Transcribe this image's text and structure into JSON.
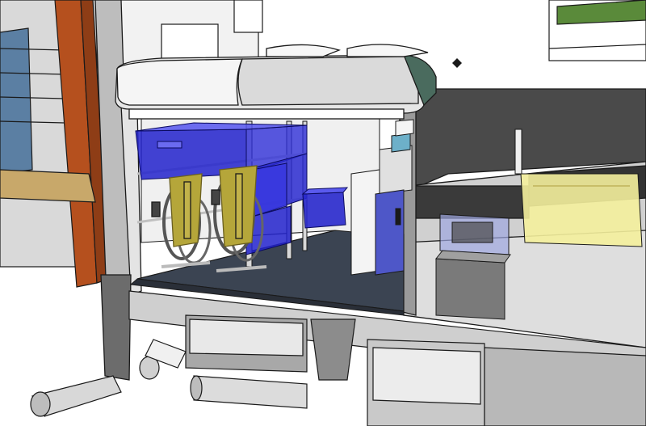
{
  "scene": {
    "description_visible_text": "",
    "colors": {
      "background": "#ffffff",
      "outline": "#1a1a1a",
      "wall_grey": "#c8c8c8",
      "floor_dark": "#3b4452",
      "counter_dark": "#4a4a4a",
      "wood": "#c8a86a",
      "red_post": "#b5501e",
      "blue_panel": "#5b7fa3",
      "storage_blue": "#2222cc",
      "bike_yellow": "#b5a63a",
      "light_yellow": "#f4ef9c",
      "glass_blue": "#9ea7e0",
      "mattress": "#e6e6e6",
      "mattress_shadow": "#9a9a9a",
      "green_grass": "#5a8a3a",
      "box_grey": "#7a7a7a"
    },
    "icons": [
      "bike-icon",
      "storage-crate-icon",
      "mattress-icon",
      "cabinet-icon"
    ]
  }
}
